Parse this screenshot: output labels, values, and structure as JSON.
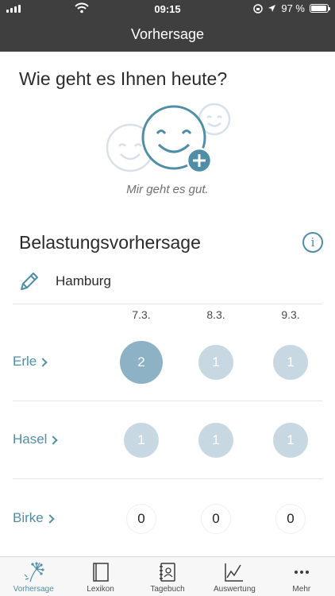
{
  "status": {
    "time": "09:15",
    "battery": "97 %",
    "battery_level": 0.97
  },
  "nav": {
    "title": "Vorhersage"
  },
  "mood": {
    "question": "Wie geht es Ihnen heute?",
    "caption": "Mir geht es gut."
  },
  "forecast": {
    "title": "Belastungsvorhersage",
    "location": "Hamburg",
    "dates": [
      "7.3.",
      "8.3.",
      "9.3."
    ],
    "plants": [
      {
        "name": "Erle",
        "levels": [
          "2",
          "1",
          "1"
        ]
      },
      {
        "name": "Hasel",
        "levels": [
          "1",
          "1",
          "1"
        ]
      },
      {
        "name": "Birke",
        "levels": [
          "0",
          "0",
          "0"
        ]
      }
    ]
  },
  "tabs": [
    {
      "label": "Vorhersage",
      "icon": "dandelion-icon",
      "active": true
    },
    {
      "label": "Lexikon",
      "icon": "book-icon",
      "active": false
    },
    {
      "label": "Tagebuch",
      "icon": "diary-icon",
      "active": false
    },
    {
      "label": "Auswertung",
      "icon": "chart-line-icon",
      "active": false
    },
    {
      "label": "Mehr",
      "icon": "more-dots-icon",
      "active": false
    }
  ],
  "colors": {
    "accent": "#4f8ea6",
    "level_2": "#8db1c5",
    "level_1": "#c8d8e3",
    "header": "#3f3f3f"
  }
}
